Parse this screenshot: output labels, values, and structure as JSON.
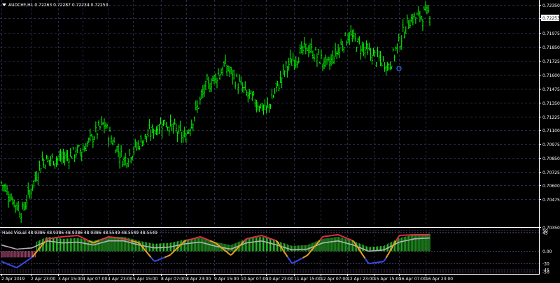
{
  "window": {
    "symbol_caption": "AUDCHF,H1  0.72263 0.72287 0.72234 0.72253",
    "current_price": "0.72253"
  },
  "colors": {
    "background": "#000000",
    "candle": "#00ff00",
    "grid": "#3a3a6a",
    "axis_text": "#ffffff",
    "price_box": "#ffffff",
    "histogram_pos": "#2fd12f",
    "histogram_neg": "#d25a8c",
    "line_red": "#e8304a",
    "line_gray": "#b4b4b4",
    "line_orange": "#f0a020",
    "line_blue": "#3a4ef0",
    "level_line": "#7a5a9a"
  },
  "price_axis": {
    "labels": [
      "0.72350",
      "0.72225",
      "0.71975",
      "0.71850",
      "0.71725",
      "0.71600",
      "0.71475",
      "0.71350",
      "0.71225",
      "0.71100",
      "0.70975",
      "0.70850",
      "0.70725",
      "0.70600",
      "0.70475",
      "0.70350"
    ],
    "grid_values": [
      "0.72350",
      "0.72225",
      "0.71975",
      "0.71850",
      "0.71725",
      "0.71600",
      "0.71475",
      "0.71350",
      "0.71225",
      "0.71100",
      "0.70975",
      "0.70850",
      "0.70725",
      "0.70600",
      "0.70475"
    ]
  },
  "time_axis": {
    "labels": [
      "2 Apr 2019",
      "2 Apr 23:00",
      "3 Apr 15:00",
      "4 Apr 07:00",
      "4 Apr 23:00",
      "5 Apr 15:00",
      "8 Apr 07:00",
      "8 Apr 23:00",
      "9 Apr 15:00",
      "10 Apr 07:00",
      "10 Apr 23:00",
      "11 Apr 15:00",
      "12 Apr 07:00",
      "12 Apr 23:00",
      "15 Apr 15:00",
      "16 Apr 07:00",
      "16 Apr 23:00"
    ]
  },
  "indicator": {
    "caption": "Haos Visual 48.9386 48.9386 48.9386 48.9386 48.5549 48.5549 48.5549",
    "axis_labels": [
      "50",
      "45",
      "0.00",
      "-30",
      "-45",
      "-50"
    ]
  },
  "chart_data": [
    {
      "type": "line",
      "symbol": "AUDCHF",
      "timeframe": "H1",
      "style": "ohlc-bars",
      "x": [
        "2 Apr 2019",
        "2 Apr 23:00",
        "3 Apr 15:00",
        "4 Apr 07:00",
        "4 Apr 23:00",
        "5 Apr 15:00",
        "8 Apr 07:00",
        "8 Apr 23:00",
        "9 Apr 15:00",
        "10 Apr 07:00",
        "10 Apr 23:00",
        "11 Apr 15:00",
        "12 Apr 07:00",
        "12 Apr 23:00",
        "15 Apr 15:00",
        "16 Apr 07:00",
        "16 Apr 23:00"
      ],
      "series": [
        {
          "values": [
            0.7075,
            0.7048,
            0.7095,
            0.7097,
            0.7105,
            0.7128,
            0.7095,
            0.7115,
            0.713,
            0.7115,
            0.716,
            0.718,
            0.7155,
            0.714,
            0.718,
            0.7197,
            0.718,
            0.7208,
            0.7192,
            0.718,
            0.7222,
            0.7228
          ]
        }
      ],
      "ylim": [
        0.7035,
        0.7235
      ],
      "grid": true
    },
    {
      "type": "line",
      "name": "Haos Visual",
      "ylim": [
        -55,
        55
      ],
      "levels": [
        50,
        45,
        0,
        -30,
        -45,
        -50
      ],
      "series": [
        {
          "values": [
            -25,
            -40,
            -15,
            30,
            35,
            38,
            20,
            35,
            30,
            20,
            -25,
            -10,
            25,
            35,
            20,
            -10,
            30,
            38,
            25,
            -30,
            -10,
            35,
            40,
            25,
            -30,
            -25,
            38,
            40,
            40
          ]
        },
        {
          "values": [
            15,
            5,
            8,
            25,
            20,
            22,
            15,
            25,
            25,
            15,
            8,
            10,
            18,
            22,
            12,
            5,
            20,
            25,
            15,
            3,
            5,
            20,
            25,
            15,
            0,
            3,
            22,
            30,
            32
          ]
        }
      ]
    }
  ]
}
